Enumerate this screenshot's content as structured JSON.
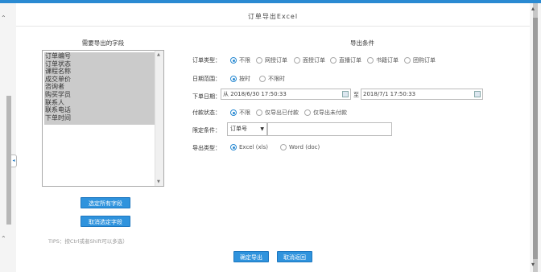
{
  "dialog": {
    "title": "订单导出Excel"
  },
  "fields_panel": {
    "title": "需要导出的字段",
    "items": [
      "订单编号",
      "订单状态",
      "课程名称",
      "成交单价",
      "咨询者",
      "购买学员",
      "联系人",
      "联系电话",
      "下单时间"
    ],
    "select_all_label": "选定所有字段",
    "deselect_label": "取消选定字段",
    "tips": "TIPS：按Ctrl或者Shift可以多选）"
  },
  "conditions": {
    "title": "导出条件",
    "order_type": {
      "label": "订单类型：",
      "options": [
        "不限",
        "网授订单",
        "面授订单",
        "直播订单",
        "书籍订单",
        "团购订单"
      ],
      "selected": 0
    },
    "date_range": {
      "label": "日期范围：",
      "options": [
        "按时",
        "不限时"
      ],
      "selected": 0
    },
    "order_date": {
      "label": "下单日期：",
      "from_prefix": "从",
      "from_value": "2018/6/30 17:50:33",
      "to_label": "至",
      "to_value": "2018/7/1 17:50:33"
    },
    "payment_status": {
      "label": "付款状态：",
      "options": [
        "不限",
        "仅导出已付款",
        "仅导出未付款"
      ],
      "selected": 0
    },
    "limit": {
      "label": "限定条件：",
      "select_value": "订单号",
      "input_value": ""
    },
    "export_type": {
      "label": "导出类型：",
      "options": [
        "Excel (xls)",
        "Word (doc)"
      ],
      "selected": 0
    }
  },
  "footer": {
    "confirm_label": "确定导出",
    "cancel_label": "取消返回"
  },
  "colors": {
    "accent": "#2a8ad2",
    "button": "#2f93dd",
    "list_highlight": "#cbcbcb"
  }
}
